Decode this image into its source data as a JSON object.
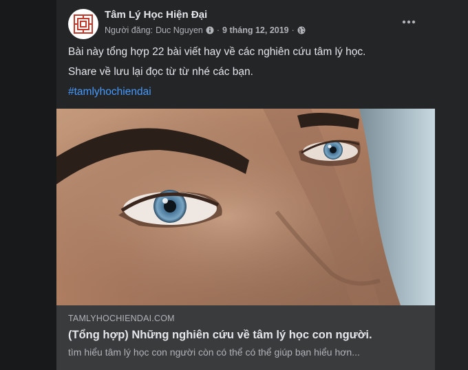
{
  "post": {
    "page_name": "Tâm Lý Học Hiện Đại",
    "posted_by_label": "Người đăng:",
    "author": "Duc Nguyen",
    "separator": "·",
    "date": "9 tháng 12, 2019",
    "privacy_icon": "globe-icon",
    "verified_icon": "info-badge-icon",
    "more_icon": "more-horizontal-icon",
    "text_lines": [
      "Bài này tổng hợp 22 bài viết hay về các nghiên cứu tâm lý học.",
      "Share về lưu lại đọc từ từ nhé các bạn."
    ],
    "hashtag": "#tamlyhochiendai"
  },
  "link_preview": {
    "domain": "TAMLYHOCHIENDAI.COM",
    "title": "(Tổng hợp) Những nghiên cứu về tâm lý học con người.",
    "description": "tìm hiểu tâm lý học con người còn có thể có thể giúp bạn hiểu hơn..."
  },
  "colors": {
    "background": "#18191a",
    "card": "#242526",
    "footer": "#3a3b3c",
    "primary_text": "#e4e6eb",
    "secondary_text": "#b0b3b8",
    "link": "#4599ff"
  }
}
